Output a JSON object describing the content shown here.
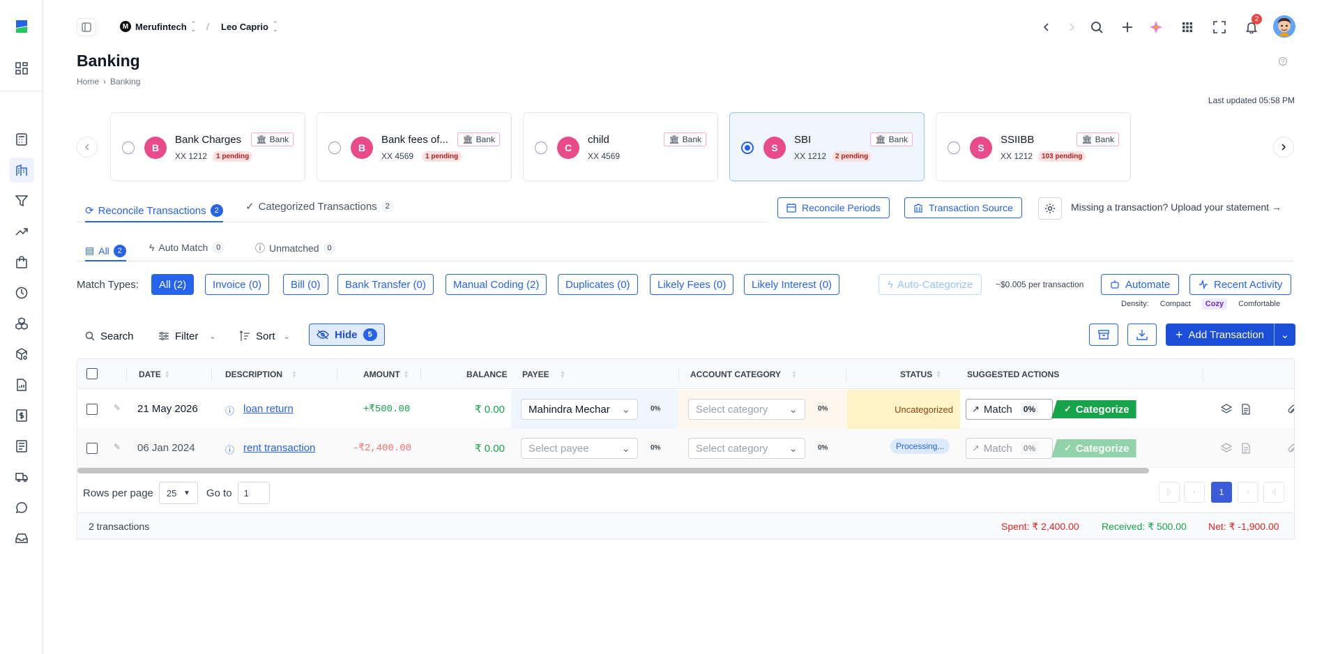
{
  "topbar": {
    "org": "Merufintech",
    "org_initial": "M",
    "user": "Leo Caprio",
    "notifications": "2"
  },
  "page": {
    "title": "Banking",
    "breadcrumb": [
      "Home",
      "Banking"
    ],
    "last_updated": "Last updated 05:58 PM"
  },
  "accounts": [
    {
      "initial": "B",
      "name": "Bank Charges",
      "mask": "XX 1212",
      "pending": "1 pending",
      "tag": "Bank",
      "selected": false
    },
    {
      "initial": "B",
      "name": "Bank fees of...",
      "mask": "XX 4569",
      "pending": "1 pending",
      "tag": "Bank",
      "selected": false
    },
    {
      "initial": "C",
      "name": "child",
      "mask": "XX 4569",
      "pending": "",
      "tag": "Bank",
      "selected": false
    },
    {
      "initial": "S",
      "name": "SBI",
      "mask": "XX 1212",
      "pending": "2 pending",
      "tag": "Bank",
      "selected": true
    },
    {
      "initial": "S",
      "name": "SSIIBB",
      "mask": "XX 1212",
      "pending": "103 pending",
      "tag": "Bank",
      "selected": false
    }
  ],
  "main_tabs": [
    {
      "label": "Reconcile Transactions",
      "count": "2"
    },
    {
      "label": "Categorized Transactions",
      "count": "2"
    }
  ],
  "actions": {
    "reconcile_periods": "Reconcile Periods",
    "transaction_source": "Transaction Source",
    "missing": "Missing a transaction? Upload your statement →"
  },
  "sub_tabs": [
    {
      "label": "All",
      "count": "2"
    },
    {
      "label": "Auto Match",
      "count": "0"
    },
    {
      "label": "Unmatched",
      "count": "0"
    }
  ],
  "match_types": {
    "label": "Match Types:",
    "chips": [
      "All (2)",
      "Invoice (0)",
      "Bill (0)",
      "Bank Transfer (0)",
      "Manual Coding (2)",
      "Duplicates (0)",
      "Likely Fees (0)",
      "Likely Interest (0)"
    ]
  },
  "auto": {
    "auto_categorize": "Auto-Categorize",
    "per_transaction": "~$0.005 per transaction",
    "automate": "Automate",
    "recent_activity": "Recent Activity"
  },
  "density": {
    "label": "Density:",
    "options": [
      "Compact",
      "Cozy",
      "Comfortable"
    ],
    "active": "Cozy"
  },
  "toolbar": {
    "search": "Search",
    "filter": "Filter",
    "sort": "Sort",
    "hide": "Hide",
    "hide_count": "5",
    "add": "Add Transaction"
  },
  "columns": [
    "DATE",
    "DESCRIPTION",
    "AMOUNT",
    "BALANCE",
    "PAYEE",
    "ACCOUNT CATEGORY",
    "STATUS",
    "SUGGESTED ACTIONS"
  ],
  "rows": [
    {
      "date": "21 May 2026",
      "description": "loan return",
      "amount": "+₹500.00",
      "balance": "₹ 0.00",
      "payee": "Mahindra Mechar",
      "payee_pct": "0%",
      "category": "Select category",
      "cat_pct": "0%",
      "status": "Uncategorized",
      "match": "Match",
      "match_pct": "0%",
      "categorize": "Categorize"
    },
    {
      "date": "06 Jan 2024",
      "description": "rent transaction",
      "amount": "-₹2,400.00",
      "balance": "₹ 0.00",
      "payee": "Select payee",
      "payee_pct": "0%",
      "category": "Select category",
      "cat_pct": "0%",
      "status": "Processing...",
      "match": "Match",
      "match_pct": "0%",
      "categorize": "Categorize"
    }
  ],
  "pagination": {
    "rows_per_page_label": "Rows per page",
    "rows_per_page": "25",
    "goto_label": "Go to",
    "goto_value": "1",
    "current_page": "1"
  },
  "summary": {
    "count": "2 transactions",
    "spent": "Spent: ₹ 2,400.00",
    "received": "Received: ₹ 500.00",
    "net": "Net: ₹ -1,900.00"
  },
  "colors": {
    "accent": "#2563eb",
    "green": "#16a34a",
    "red": "#dc2626",
    "pink": "#e84a8a"
  }
}
